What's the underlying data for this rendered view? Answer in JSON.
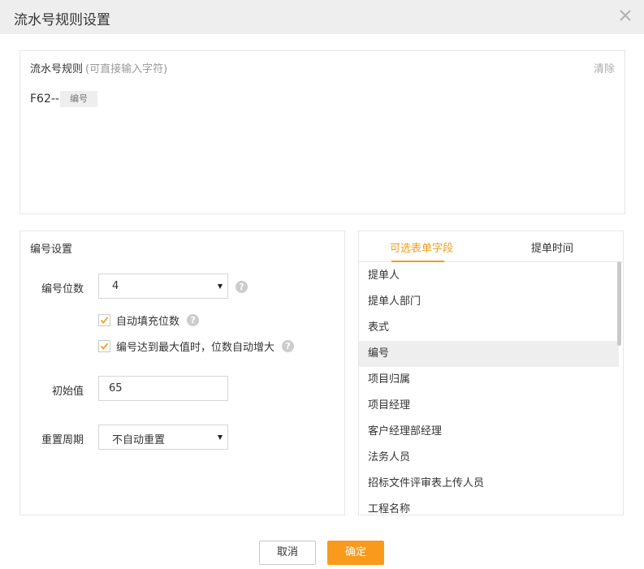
{
  "dialog": {
    "title": "流水号规则设置",
    "close_icon": "close-icon"
  },
  "rule": {
    "label": "流水号规则",
    "hint": "(可直接输入字符)",
    "clear_label": "清除",
    "prefix": "F62--",
    "token": "编号"
  },
  "settings": {
    "title": "编号设置",
    "digits_label": "编号位数",
    "digits_value": "4",
    "auto_fill_label": "自动填充位数",
    "auto_fill_checked": true,
    "auto_grow_label": "编号达到最大值时，位数自动增大",
    "auto_grow_checked": true,
    "initial_label": "初始值",
    "initial_value": "65",
    "reset_label": "重置周期",
    "reset_value": "不自动重置",
    "help_glyph": "?"
  },
  "fields": {
    "tabs": [
      {
        "label": "可选表单字段",
        "active": true
      },
      {
        "label": "提单时间",
        "active": false
      }
    ],
    "items": [
      {
        "label": "提单人"
      },
      {
        "label": "提单人部门"
      },
      {
        "label": "表式"
      },
      {
        "label": "编号",
        "selected": true
      },
      {
        "label": "项目归属"
      },
      {
        "label": "项目经理"
      },
      {
        "label": "客户经理部经理"
      },
      {
        "label": "法务人员"
      },
      {
        "label": "招标文件评审表上传人员"
      },
      {
        "label": "工程名称"
      }
    ]
  },
  "footer": {
    "cancel_label": "取消",
    "ok_label": "确定"
  },
  "colors": {
    "accent": "#f59c1a",
    "ok_button": "#fa9a1d",
    "titlebar": "#eeeeee",
    "selected_row": "#eeeeee"
  }
}
